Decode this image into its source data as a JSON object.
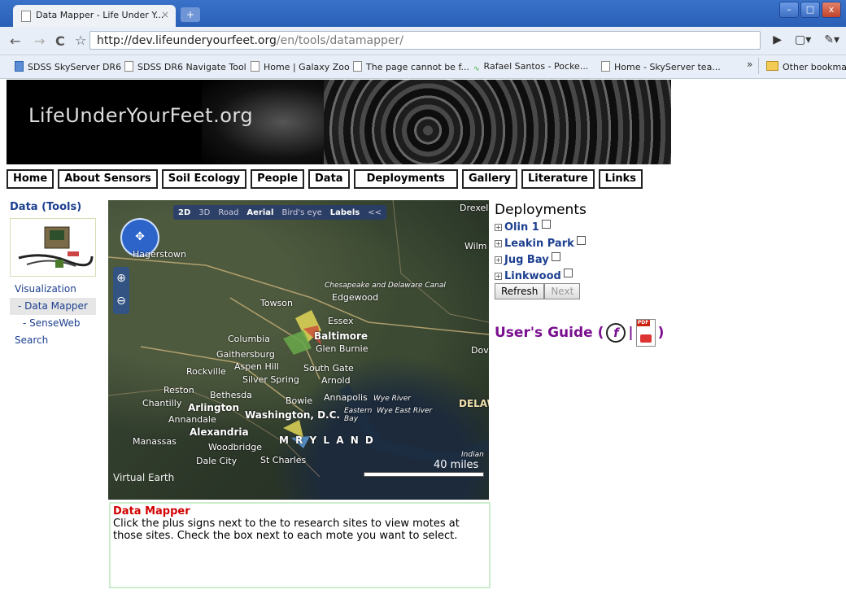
{
  "browser": {
    "tab_title": "Data Mapper - Life Under Y...",
    "tab_close": "×",
    "new_tab": "+",
    "url_host": "http://dev.lifeunderyourfeet.org",
    "url_path": "/en/tools/datamapper/",
    "bookmarks": [
      "SDSS SkyServer DR6",
      "SDSS DR6 Navigate Tool",
      "Home | Galaxy Zoo",
      "The page cannot be f...",
      "Rafael Santos - Pocke...",
      "Home - SkyServer tea..."
    ],
    "other_bookmarks": "Other bookmarks",
    "overflow": "»"
  },
  "site": {
    "logo": "LifeUnderYourFeet.org",
    "nav": [
      "Home",
      "About Sensors",
      "Soil Ecology",
      "People",
      "Data",
      "Deployments",
      "Gallery",
      "Literature",
      "Links"
    ]
  },
  "sidebar": {
    "title": "Data (Tools)",
    "links": [
      "Visualization",
      "- Data Mapper",
      "- SenseWeb",
      "Search"
    ]
  },
  "map": {
    "controls": [
      "2D",
      "3D",
      "Road",
      "Aerial",
      "Bird's eye",
      "Labels",
      "<<"
    ],
    "labels": [
      "Hagerstown",
      "Towson",
      "Edgewood",
      "Essex",
      "Baltimore",
      "Columbia",
      "Glen Burnie",
      "Gaithersburg",
      "Aspen Hill",
      "Rockville",
      "South Gate",
      "Silver Spring",
      "Arnold",
      "Bethesda",
      "Bowie",
      "Annapolis",
      "Reston",
      "Chantilly",
      "Arlington",
      "Washington, D.C.",
      "Annandale",
      "Alexandria",
      "Manassas",
      "Woodbridge",
      "Dale City",
      "St Charles",
      "M  R  Y  L  A  N  D",
      "DELAW",
      "Drexel",
      "Wilm",
      "Dove",
      "Chesapeake and Delaware Canal",
      "Wye River",
      "Wye East River",
      "Eastern Bay",
      "Indian"
    ],
    "scale": "40 miles",
    "brand": "Virtual Earth"
  },
  "info": {
    "title": "Data Mapper",
    "text": "Click the plus signs next to the to research sites to view motes at those sites. Check the box next to each mote you want to select."
  },
  "deployments": {
    "title": "Deployments",
    "items": [
      "Olin 1",
      "Leakin Park",
      "Jug Bay",
      "Linkwood"
    ],
    "refresh": "Refresh",
    "next": "Next"
  },
  "guide": {
    "label": "User's Guide (",
    "sep": "|",
    "close": ")"
  }
}
